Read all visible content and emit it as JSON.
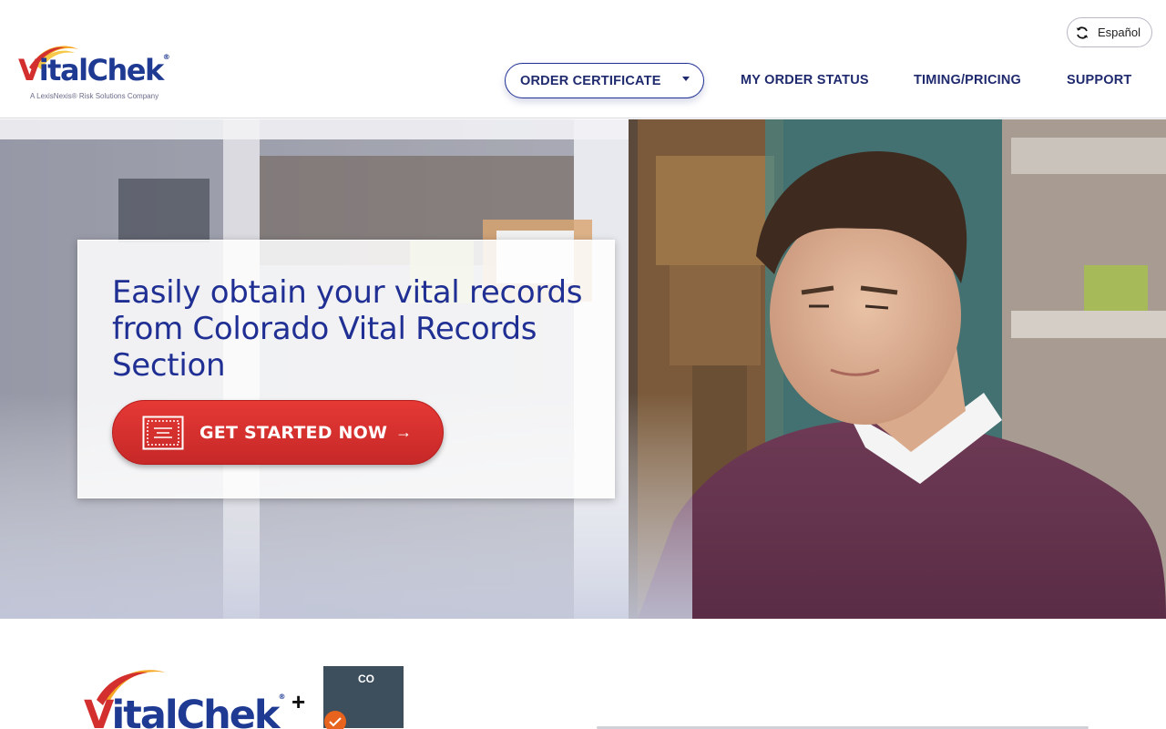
{
  "header": {
    "logo": {
      "brand_v": "V",
      "brand_rest": "italChek",
      "registered": "®",
      "tagline": "A LexisNexis® Risk Solutions Company"
    },
    "language_button": {
      "label": "Español",
      "icon": "refresh-icon"
    },
    "nav": {
      "order_certificate": "ORDER CERTIFICATE",
      "order_status": "MY ORDER STATUS",
      "timing_pricing": "TIMING/PRICING",
      "support": "SUPPORT"
    }
  },
  "hero": {
    "title": "Easily obtain your vital records from Colorado Vital Records Section",
    "cta_label": "GET STARTED NOW",
    "cta_arrow": "→",
    "cta_icon": "certificate-icon"
  },
  "partners": {
    "brand_v": "V",
    "brand_rest": "italChek",
    "registered": "®",
    "plus": "+",
    "state_abbr": "CO",
    "state_badge_icon": "checkmark-seal-icon"
  },
  "colors": {
    "brand_blue": "#1f2f93",
    "nav_text": "#1f2a6e",
    "cta_red": "#d32f2f",
    "logo_swoosh_yellow": "#f5a623",
    "state_fill": "#3d4e5c",
    "seal_orange": "#e8641e"
  }
}
